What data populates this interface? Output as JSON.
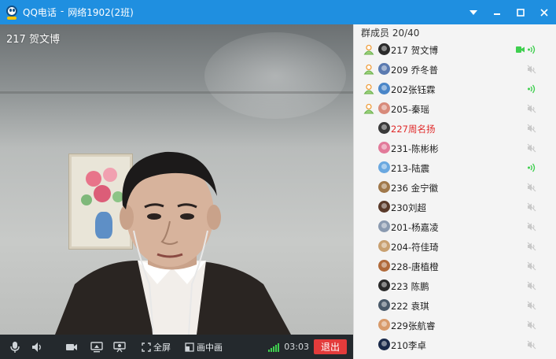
{
  "window": {
    "app_name": "QQ电话",
    "separator": "-",
    "group_name": "网络1902(2班)",
    "controls": [
      "settings-icon",
      "minimize-icon",
      "maximize-icon",
      "close-icon"
    ]
  },
  "video": {
    "caller_name": "217 贺文博"
  },
  "toolbar": {
    "fullscreen_label": "全屏",
    "pip_label": "画中画",
    "timer": "03:03",
    "exit_label": "退出",
    "icons": [
      "microphone-icon",
      "speaker-icon",
      "camera-icon",
      "screen-share-icon",
      "presentation-icon",
      "fullscreen-icon",
      "picture-in-picture-icon",
      "signal-strength-icon"
    ]
  },
  "members": {
    "header": "群成员 20/40",
    "list": [
      {
        "name": "217 贺文博",
        "role": "admin",
        "status": "video-speaking",
        "avatar_color": "#2a2a2a"
      },
      {
        "name": "209  乔冬普",
        "role": "admin",
        "status": "muted",
        "avatar_color": "#5a7ab0"
      },
      {
        "name": "202张钰霖",
        "role": "admin",
        "status": "speaking",
        "avatar_color": "#4a86c8"
      },
      {
        "name": "205-秦瑶",
        "role": "admin",
        "status": "muted",
        "avatar_color": "#d88a7a"
      },
      {
        "name": "227周名扬",
        "role": "member",
        "status": "muted",
        "avatar_color": "#3a3a3a",
        "highlight": true
      },
      {
        "name": "231-陈彬彬",
        "role": "member",
        "status": "muted",
        "avatar_color": "#e27a9a"
      },
      {
        "name": "213-陆震",
        "role": "member",
        "status": "speaking",
        "avatar_color": "#6aa8e0"
      },
      {
        "name": "236 金宁徽",
        "role": "member",
        "status": "muted",
        "avatar_color": "#a0784a"
      },
      {
        "name": "230刘超",
        "role": "member",
        "status": "muted",
        "avatar_color": "#5a3a2a"
      },
      {
        "name": "201-杨嘉凌",
        "role": "member",
        "status": "muted",
        "avatar_color": "#8a9ab0"
      },
      {
        "name": "204-符佳琦",
        "role": "member",
        "status": "muted",
        "avatar_color": "#c8a070"
      },
      {
        "name": "228-唐植橙",
        "role": "member",
        "status": "muted",
        "avatar_color": "#b06a3a"
      },
      {
        "name": "223 陈鹏",
        "role": "member",
        "status": "muted",
        "avatar_color": "#2a2a2a"
      },
      {
        "name": "222 袁琪",
        "role": "member",
        "status": "muted",
        "avatar_color": "#4a5a6a"
      },
      {
        "name": "229张航睿",
        "role": "member",
        "status": "muted",
        "avatar_color": "#d89a6a"
      },
      {
        "name": "210李卓",
        "role": "member",
        "status": "muted",
        "avatar_color": "#1a2a4a"
      }
    ]
  },
  "colors": {
    "titlebar": "#1f8fe0",
    "toolbar": "#24292d",
    "exit": "#e33b3b",
    "speaking": "#3fcf4f",
    "muted": "#c9c9c9",
    "admin_icon": "#f0a040",
    "highlight_name": "#e02a2a"
  }
}
